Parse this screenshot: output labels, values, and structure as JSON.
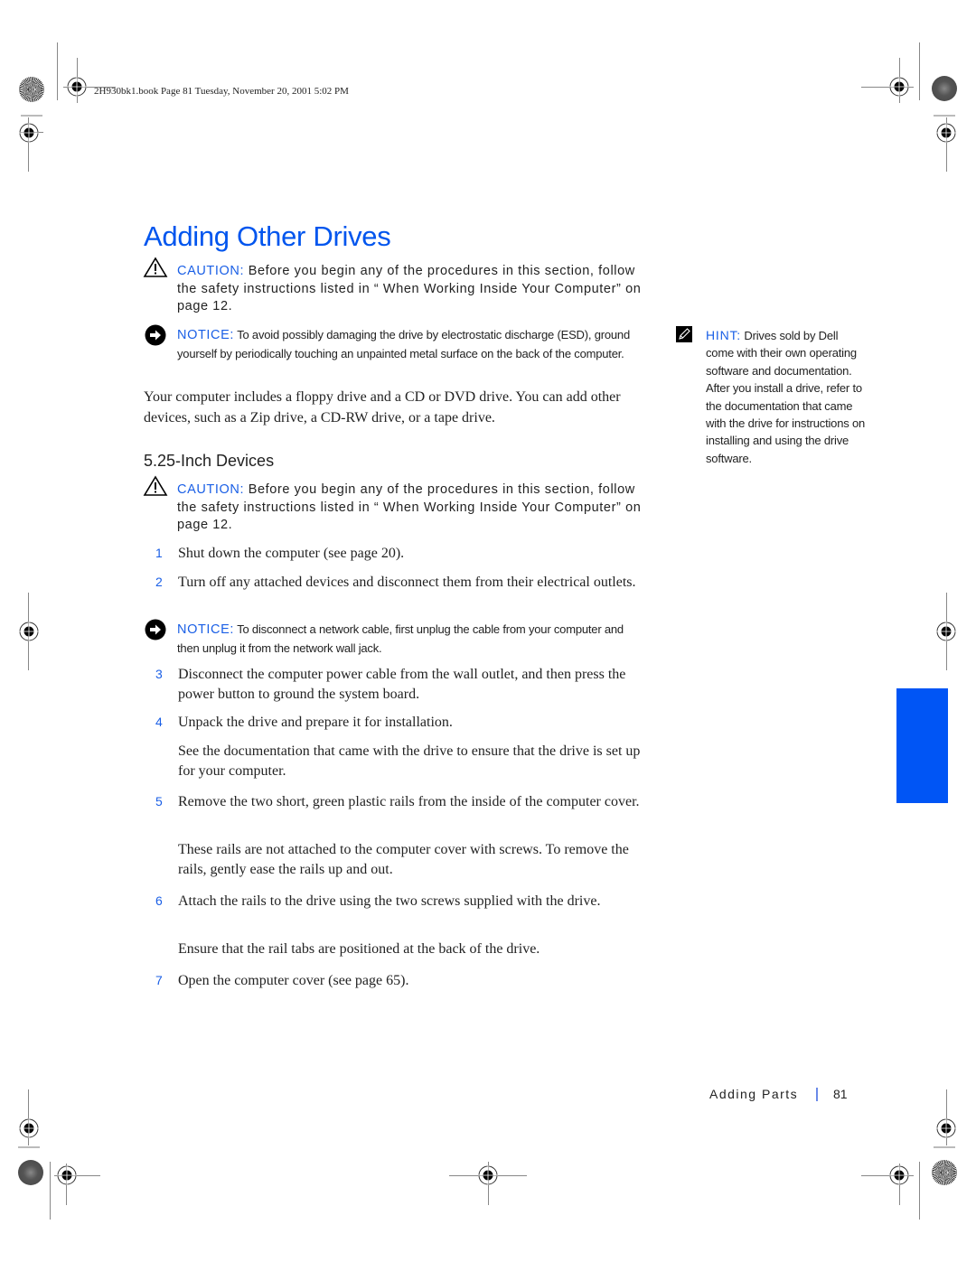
{
  "print_header": {
    "text": "2H930bk1.book  Page 81  Tuesday, November 20, 2001  5:02 PM"
  },
  "title": "Adding Other Drives",
  "caution_1": {
    "icon": "warning-triangle-icon",
    "label": "CAUTION:",
    "text": " Before you begin any of the procedures in this section, follow the safety instructions listed in “ When Working Inside Your Computer”  on page 12."
  },
  "notice_1": {
    "icon": "arrow-circle-icon",
    "label": "NOTICE:",
    "text": " To avoid possibly damaging the drive by electrostatic discharge (ESD), ground yourself by periodically touching an unpainted metal surface on the back of the computer."
  },
  "intro_paragraph": "Your computer includes a floppy drive and a CD or DVD drive. You can add other devices, such as a Zip drive, a CD-RW drive, or a tape drive.",
  "section_heading": "5.25-Inch Devices",
  "caution_2": {
    "icon": "warning-triangle-icon",
    "label": "CAUTION:",
    "text": " Before you begin any of the procedures in this section, follow the safety instructions listed in “ When Working Inside Your Computer”  on page 12."
  },
  "notice_2": {
    "icon": "arrow-circle-icon",
    "label": "NOTICE:",
    "text": " To disconnect a network cable, first unplug the cable from your computer and then unplug it from the network wall jack."
  },
  "steps": [
    {
      "number": "1",
      "text": "Shut down the computer (see page 20)."
    },
    {
      "number": "2",
      "text": "Turn off any attached devices and disconnect them from their electrical outlets."
    },
    {
      "number": "3",
      "text": "Disconnect the computer power cable from the wall outlet, and then press the power button to ground the system board."
    },
    {
      "number": "4",
      "text": "Unpack the drive and prepare it for installation.",
      "note": "See the documentation that came with the drive to ensure that the drive is set up for your computer."
    },
    {
      "number": "5",
      "text": "Remove the two short, green plastic rails from the inside of the computer cover.",
      "note": "These rails are not attached to the computer cover with screws. To remove the rails, gently ease the rails up and out."
    },
    {
      "number": "6",
      "text": "Attach the rails to the drive using the two screws supplied with the drive.",
      "note": "Ensure that the rail tabs are positioned at the back of the drive."
    },
    {
      "number": "7",
      "text": "Open the computer cover (see page 65)."
    }
  ],
  "hint": {
    "icon": "pencil-icon",
    "label": "HINT:",
    "text": " Drives sold by Dell come with their own operating software and documentation. After you install a drive, refer to the documentation that came with the drive for instructions on installing and using the drive software."
  },
  "footer": {
    "section": "Adding Parts",
    "page_number": "81"
  },
  "colors": {
    "accent_blue": "#0055ee",
    "tab_blue": "#0055f5",
    "text": "#222222"
  }
}
